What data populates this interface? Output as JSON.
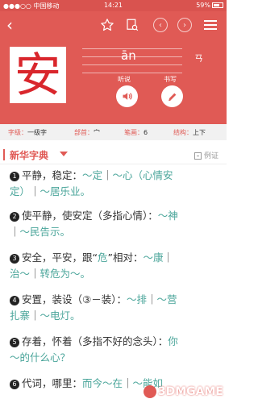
{
  "status": {
    "carrier": "中国移动",
    "time": "14:21",
    "battery": "59%"
  },
  "header": {
    "char": "安",
    "pinyin": "ān",
    "zhuyin": "ㄢ",
    "listen_label": "听说",
    "write_label": "书写"
  },
  "info": {
    "level_label": "字级：",
    "level_value": "一级字",
    "radical_label": "部首：",
    "radical_value": "宀",
    "strokes_label": "笔画：",
    "strokes_value": "6",
    "structure_label": "结构：",
    "structure_value": "上下"
  },
  "dict": {
    "title": "新华字典",
    "example_label": "例证"
  },
  "definitions": [
    {
      "num": "1",
      "line1": [
        [
          "t",
          "平静，稳定："
        ],
        [
          "g",
          "～定"
        ],
        [
          "t",
          "｜"
        ],
        [
          "g",
          "～心（心情安"
        ]
      ],
      "line2": [
        [
          "g",
          "定）"
        ],
        [
          "t",
          "｜"
        ],
        [
          "g",
          "～居乐业。"
        ]
      ]
    },
    {
      "num": "2",
      "line1": [
        [
          "t",
          "使平静，使安定（多指心情）："
        ],
        [
          "g",
          "～神"
        ]
      ],
      "line2": [
        [
          "t",
          "｜"
        ],
        [
          "g",
          "～民告示。"
        ]
      ]
    },
    {
      "num": "3",
      "line1": [
        [
          "t",
          "安全，平安，跟“"
        ],
        [
          "g",
          "危"
        ],
        [
          "t",
          "”相对："
        ],
        [
          "g",
          "～康"
        ],
        [
          "t",
          "｜"
        ]
      ],
      "line2": [
        [
          "g",
          "治～"
        ],
        [
          "t",
          "｜"
        ],
        [
          "g",
          "转危为～。"
        ]
      ]
    },
    {
      "num": "4",
      "line1": [
        [
          "t",
          "安置，装设（"
        ],
        [
          "t",
          "③"
        ],
        [
          "t",
          "－装）："
        ],
        [
          "g",
          "～排"
        ],
        [
          "t",
          "｜"
        ],
        [
          "g",
          "～营"
        ]
      ],
      "line2": [
        [
          "g",
          "扎寨"
        ],
        [
          "t",
          "｜"
        ],
        [
          "g",
          "～电灯。"
        ]
      ]
    },
    {
      "num": "5",
      "line1": [
        [
          "t",
          "存着，怀着（多指不好的念头）："
        ],
        [
          "g",
          "你"
        ]
      ],
      "line2": [
        [
          "g",
          "～的什么心？"
        ]
      ]
    },
    {
      "num": "6",
      "line1": [
        [
          "t",
          "代词，哪里："
        ],
        [
          "g",
          "而今～在"
        ],
        [
          "t",
          "｜"
        ],
        [
          "g",
          "～能如"
        ]
      ],
      "line2": []
    }
  ],
  "watermark": "3DMGAME",
  "colors": {
    "brand": "#e05a55",
    "example_green": "#4aa59a"
  }
}
